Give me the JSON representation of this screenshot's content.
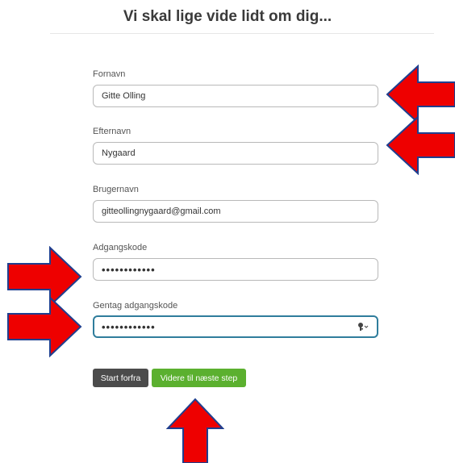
{
  "page": {
    "title": "Vi skal lige vide lidt om dig..."
  },
  "form": {
    "first_name": {
      "label": "Fornavn",
      "value": "Gitte Olling"
    },
    "last_name": {
      "label": "Efternavn",
      "value": "Nygaard"
    },
    "username": {
      "label": "Brugernavn",
      "value": "gitteollingnygaard@gmail.com"
    },
    "password": {
      "label": "Adgangskode",
      "value": "••••••••••••"
    },
    "password_repeat": {
      "label": "Gentag adgangskode",
      "value": "••••••••••••"
    }
  },
  "buttons": {
    "start_label": "Start forfra",
    "next_label": "Videre til næste step"
  },
  "colors": {
    "arrow_fill": "#ee0000",
    "arrow_stroke": "#1f3f8f",
    "next_button": "#5bb02f",
    "start_button": "#4b4b4b",
    "focus_border": "#2f7d9c"
  },
  "icons": {
    "password_manager": "key-icon"
  }
}
